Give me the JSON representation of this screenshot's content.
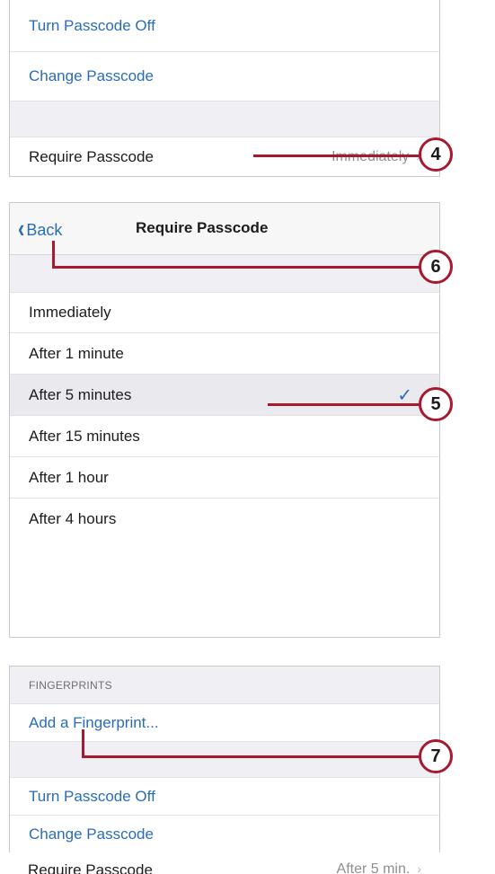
{
  "panel1": {
    "turn_off": "Turn Passcode Off",
    "change": "Change Passcode",
    "require_label": "Require Passcode",
    "require_value": "Immediately",
    "chevron": "›"
  },
  "panel2": {
    "back_label": "Back",
    "back_chevron": "‹",
    "title": "Require Passcode",
    "options": [
      "Immediately",
      "After 1 minute",
      "After 5 minutes",
      "After 15 minutes",
      "After 1 hour",
      "After 4 hours"
    ],
    "selected": "After 5 minutes",
    "checkmark": "✓"
  },
  "panel3": {
    "section_header": "FINGERPRINTS",
    "add_fingerprint": "Add a Fingerprint...",
    "turn_off": "Turn Passcode Off",
    "change": "Change Passcode",
    "require_label": "Require Passcode",
    "require_value": "After 5 min.",
    "chevron": "›"
  },
  "callouts": {
    "c4": "4",
    "c5": "5",
    "c6": "6",
    "c7": "7"
  },
  "colors": {
    "accent": "#2a6db7",
    "callout": "#a6192e",
    "group_bg": "#efeff4"
  }
}
